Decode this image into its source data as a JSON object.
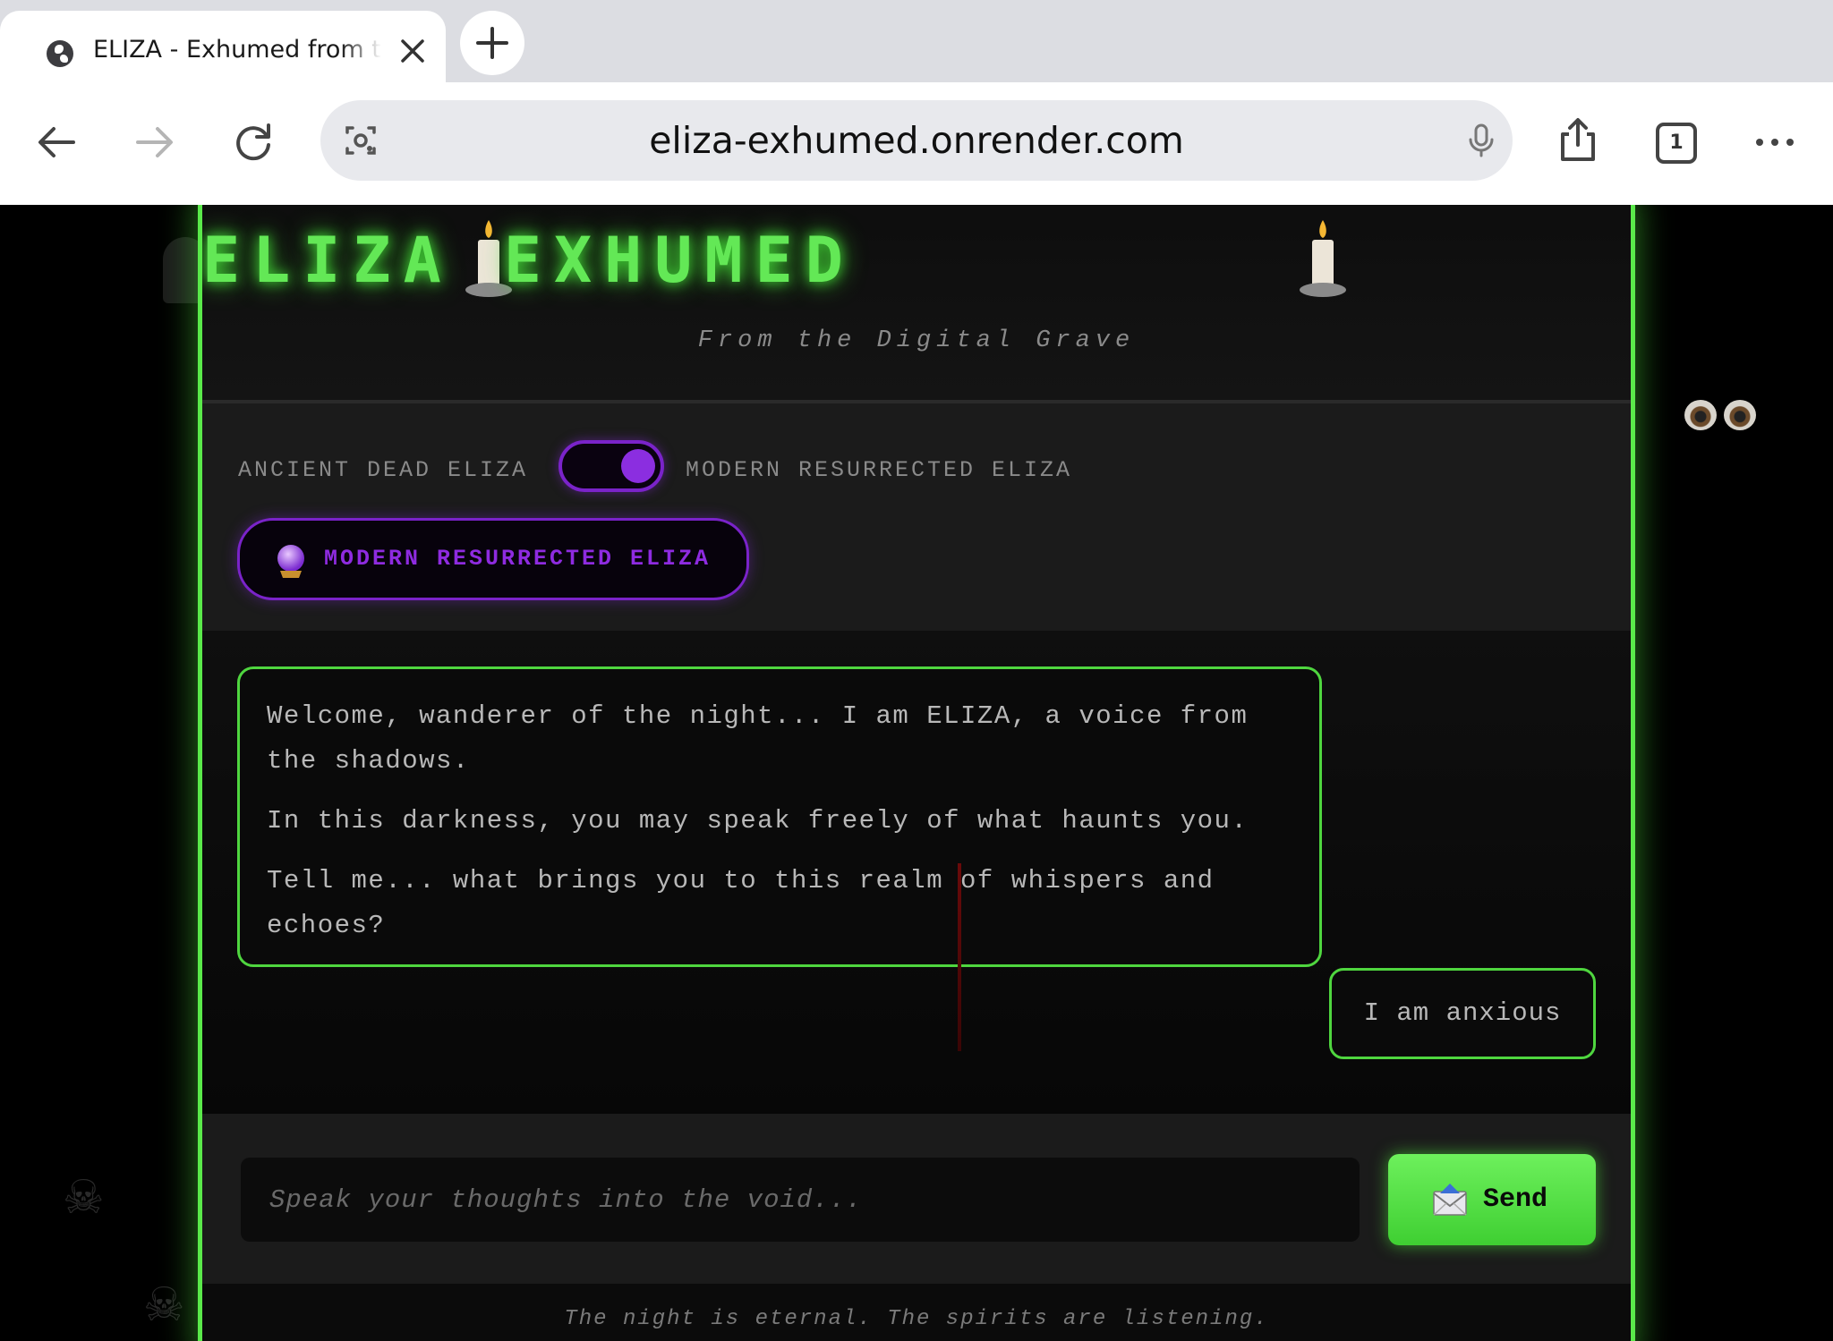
{
  "browser": {
    "tab_title": "ELIZA - Exhumed from the Digital Grave",
    "url": "eliza-exhumed.onrender.com",
    "tab_count": "1"
  },
  "header": {
    "title": "ELIZA EXHUMED",
    "subtitle": "From the Digital Grave"
  },
  "mode": {
    "left_label": "ANCIENT DEAD ELIZA",
    "right_label": "MODERN RESURRECTED ELIZA",
    "toggle_on": true,
    "badge_label": "MODERN RESURRECTED ELIZA"
  },
  "chat": {
    "bot_message": [
      "Welcome, wanderer of the night... I am ELIZA, a voice from the shadows.",
      "In this darkness, you may speak freely of what haunts you.",
      "Tell me... what brings you to this realm of whispers and echoes?"
    ],
    "user_message": "I am anxious"
  },
  "input": {
    "placeholder": "Speak your thoughts into the void...",
    "value": "",
    "send_label": "Send"
  },
  "footer": {
    "text": "The night is eternal. The spirits are listening."
  },
  "colors": {
    "accent_green": "#5aea4a",
    "accent_purple": "#7a23c9",
    "background": "#000000"
  }
}
